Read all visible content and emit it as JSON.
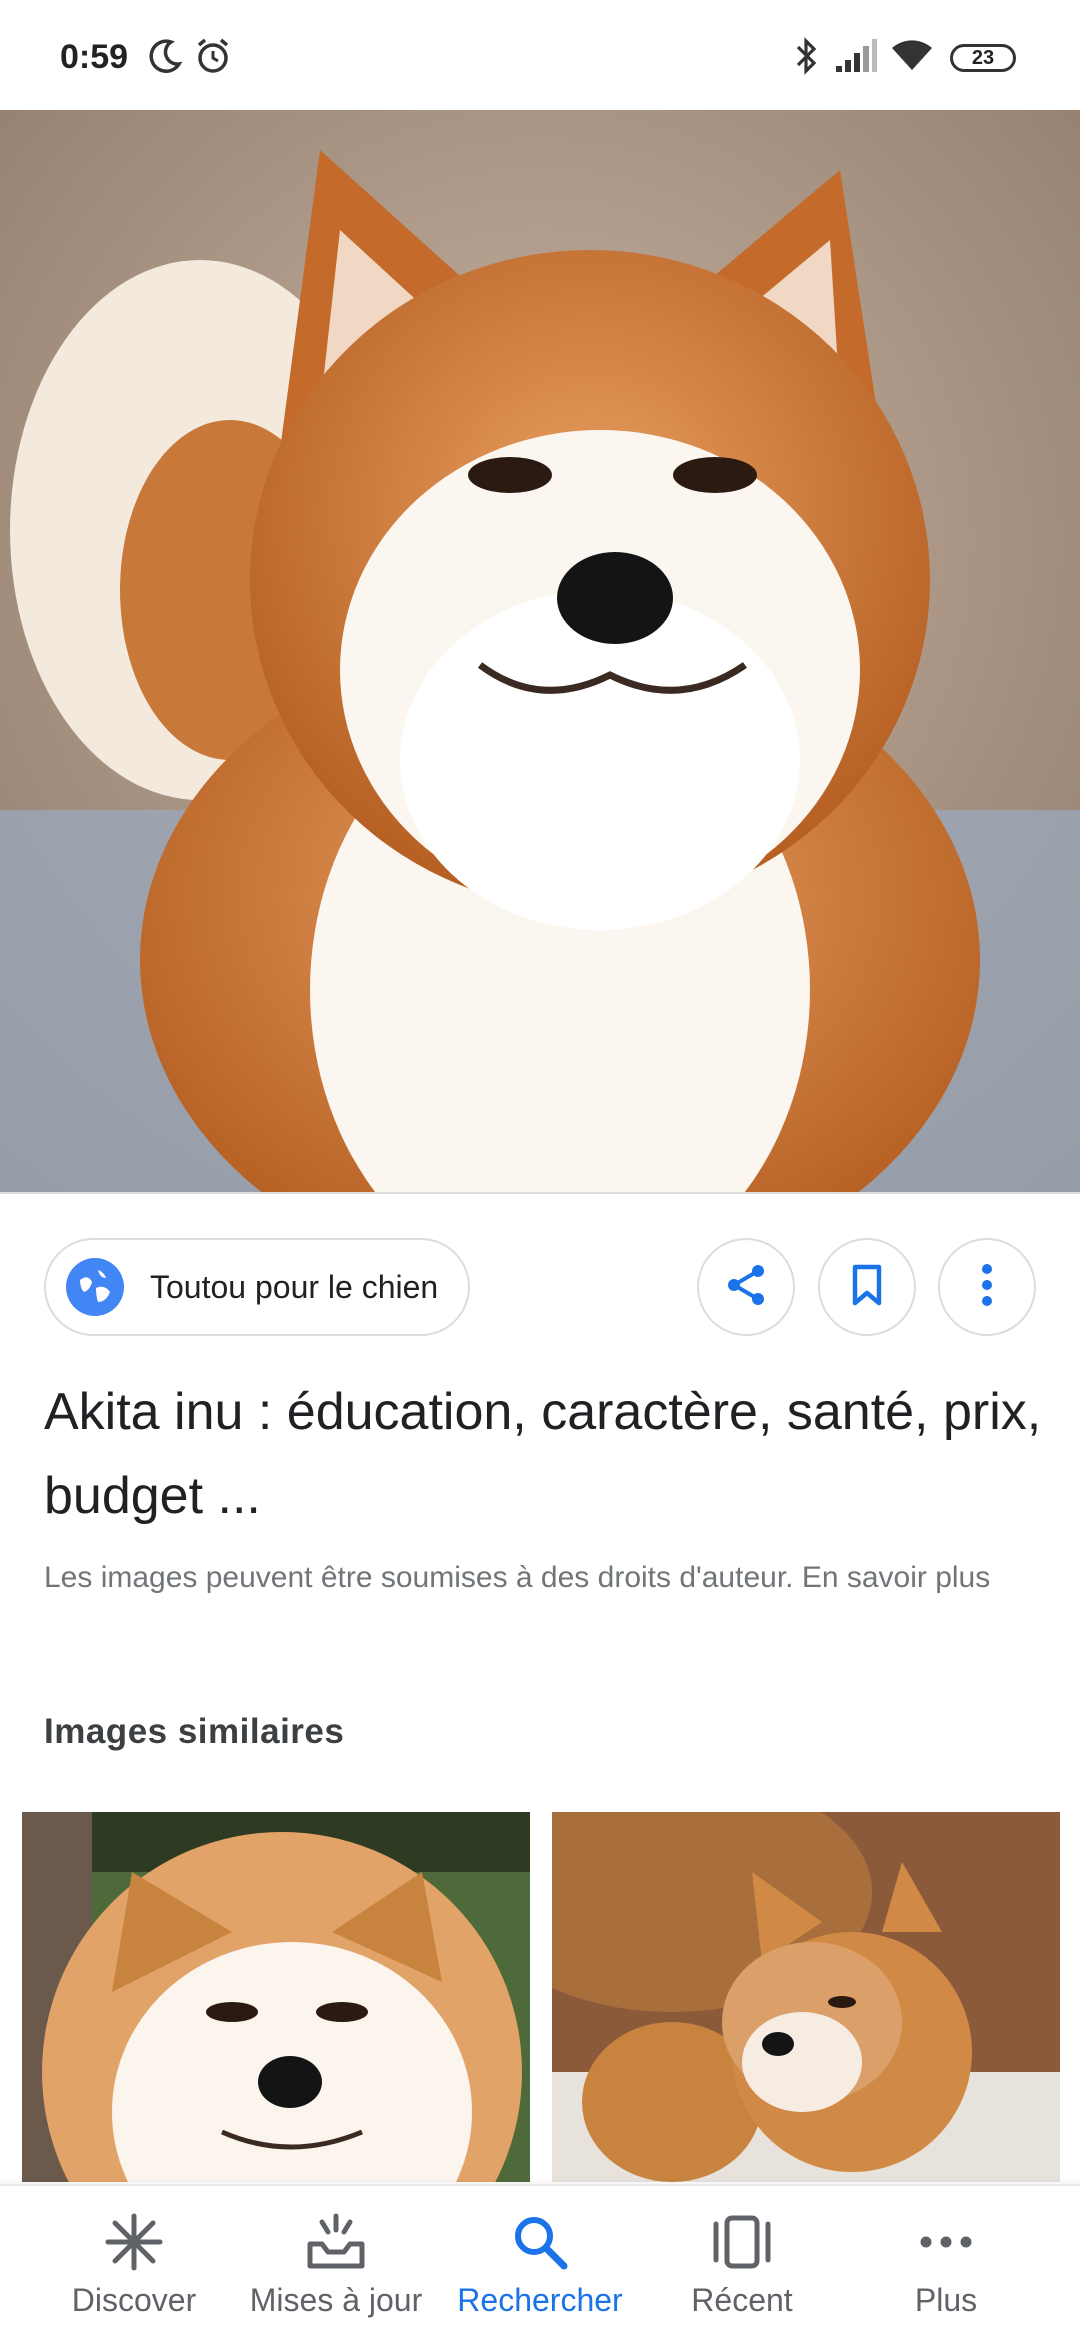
{
  "status_bar": {
    "time": "0:59",
    "battery": "23",
    "icons": [
      "moon-icon",
      "alarm-icon",
      "bluetooth-icon",
      "signal-icon",
      "wifi-icon",
      "battery-icon"
    ]
  },
  "result": {
    "source": "Toutou pour le chien",
    "title": "Akita inu : éducation, caractère, santé, prix, budget ...",
    "copyright": "Les images peuvent être soumises à des droits d'auteur. En savoir plus"
  },
  "actions": {
    "icons": [
      "share-icon",
      "bookmark-icon",
      "more-vert-icon"
    ]
  },
  "similar": {
    "heading": "Images similaires"
  },
  "bottom_nav": {
    "items": [
      {
        "label": "Discover",
        "icon": "discover-icon"
      },
      {
        "label": "Mises à jour",
        "icon": "updates-icon"
      },
      {
        "label": "Rechercher",
        "icon": "search-icon",
        "active": true
      },
      {
        "label": "Récent",
        "icon": "recent-icon"
      },
      {
        "label": "Plus",
        "icon": "more-horiz-icon"
      }
    ],
    "active_color": "#1a73e8",
    "inactive_color": "#5f6368"
  }
}
